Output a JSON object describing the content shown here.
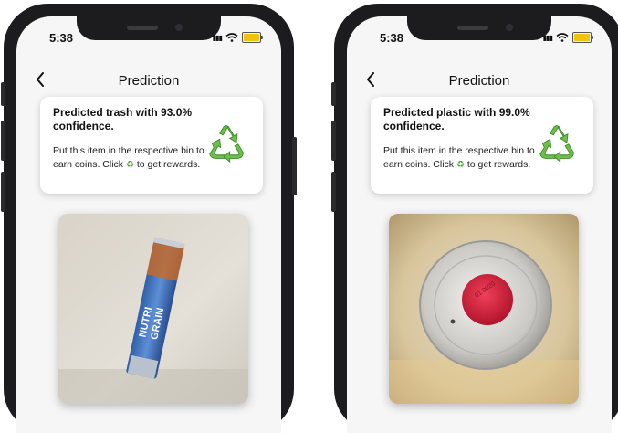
{
  "screens": [
    {
      "status_time": "5:38",
      "nav_title": "Prediction",
      "result_title": "Predicted trash with 93.0% confidence.",
      "instructions_before": "Put this item in the respective bin to earn coins. Click ",
      "instructions_icon": "♻",
      "instructions_after": " to get rewards.",
      "recycle_icon": "recycle-icon",
      "photo_subject": "crumpled cereal bar wrapper"
    },
    {
      "status_time": "5:38",
      "nav_title": "Prediction",
      "result_title": "Predicted plastic with 99.0% confidence.",
      "instructions_before": "Put this item in the respective bin to earn coins. Click ",
      "instructions_icon": "♻",
      "instructions_after": " to get rewards.",
      "recycle_icon": "recycle-icon",
      "photo_subject": "clear plastic bottle with red cap, top view"
    }
  ],
  "colors": {
    "recycle_green": "#4a9e33",
    "battery_yellow": "#f2c10a",
    "screen_bg": "#f6f6f6",
    "phone_frame": "#1c1c1e"
  }
}
